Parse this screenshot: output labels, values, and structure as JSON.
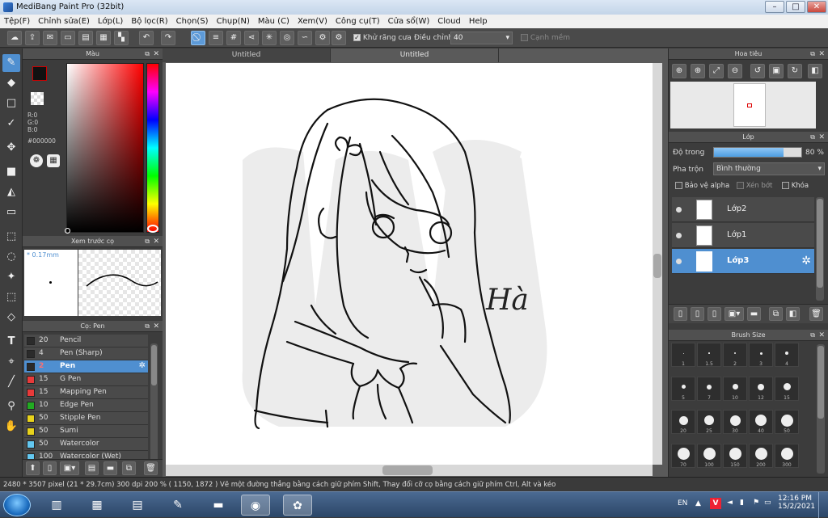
{
  "window": {
    "title": "MediBang Paint Pro (32bit)",
    "minimize": "–",
    "maximize": "□",
    "close": "✕"
  },
  "menu": [
    "Tệp(F)",
    "Chỉnh sửa(E)",
    "Lớp(L)",
    "Bộ lọc(R)",
    "Chọn(S)",
    "Chụp(N)",
    "Màu (C)",
    "Xem(V)",
    "Công cụ(T)",
    "Cửa sổ(W)",
    "Cloud",
    "Help"
  ],
  "toolbar": {
    "antialias_label": "Khử răng cưa",
    "antialias_checked": "✓",
    "adjust_label": "Điều chỉnh",
    "adjust_value": "40",
    "soft_edge_label": "Cạnh mềm"
  },
  "color_panel": {
    "title": "Màu",
    "r": "R:0",
    "g": "G:0",
    "b": "B:0",
    "hex": "#000000",
    "fg_color": "#000000"
  },
  "brush_preview": {
    "title": "Xem trước cọ",
    "size": "* 0.17mm"
  },
  "brush_list": {
    "title": "Cọ: Pen",
    "items": [
      {
        "size": "20",
        "name": "Pencil",
        "color": "#2b2b2b"
      },
      {
        "size": "4",
        "name": "Pen (Sharp)",
        "color": "#2b2b2b"
      },
      {
        "size": "2",
        "name": "Pen",
        "color": "#2b2b2b"
      },
      {
        "size": "15",
        "name": "G Pen",
        "color": "#e83a3a"
      },
      {
        "size": "15",
        "name": "Mapping Pen",
        "color": "#e83a3a"
      },
      {
        "size": "10",
        "name": "Edge Pen",
        "color": "#22aa22"
      },
      {
        "size": "50",
        "name": "Stipple Pen",
        "color": "#e8d21c"
      },
      {
        "size": "50",
        "name": "Sumi",
        "color": "#e8d21c"
      },
      {
        "size": "50",
        "name": "Watercolor",
        "color": "#63c7f0"
      },
      {
        "size": "100",
        "name": "Watercolor (Wet)",
        "color": "#63c7f0"
      }
    ],
    "selected_index": 2
  },
  "tabs": [
    "Untitled",
    "Untitled"
  ],
  "canvas": {
    "signature": "Hà"
  },
  "navigator": {
    "title": "Hoa tiêu"
  },
  "layers": {
    "title": "Lớp",
    "opacity_label": "Độ trong",
    "opacity_value": "80 %",
    "opacity_fraction": 0.8,
    "blend_label": "Pha trộn",
    "blend_value": "Bình thường",
    "protect_alpha": "Bảo vệ alpha",
    "clipping": "Xén bớt",
    "lock": "Khóa",
    "items": [
      {
        "name": "Lớp2"
      },
      {
        "name": "Lớp1"
      },
      {
        "name": "Lớp3"
      }
    ],
    "selected_index": 2
  },
  "brush_size": {
    "title": "Brush Size",
    "sizes": [
      "1",
      "1.5",
      "2",
      "3",
      "4",
      "5",
      "7",
      "10",
      "12",
      "15",
      "20",
      "25",
      "30",
      "40",
      "50",
      "70",
      "100",
      "150",
      "200",
      "300"
    ]
  },
  "status": "2480 * 3507 pixel    (21 * 29.7cm)    300 dpi    200 %    ( 1150, 1872 )    Vẽ một đường thẳng bằng cách giữ phím Shift, Thay đổi cỡ cọ bằng cách giữ phím Ctrl, Alt và kéo",
  "taskbar": {
    "lang": "EN",
    "time": "12:16 PM",
    "date": "15/2/2021"
  }
}
